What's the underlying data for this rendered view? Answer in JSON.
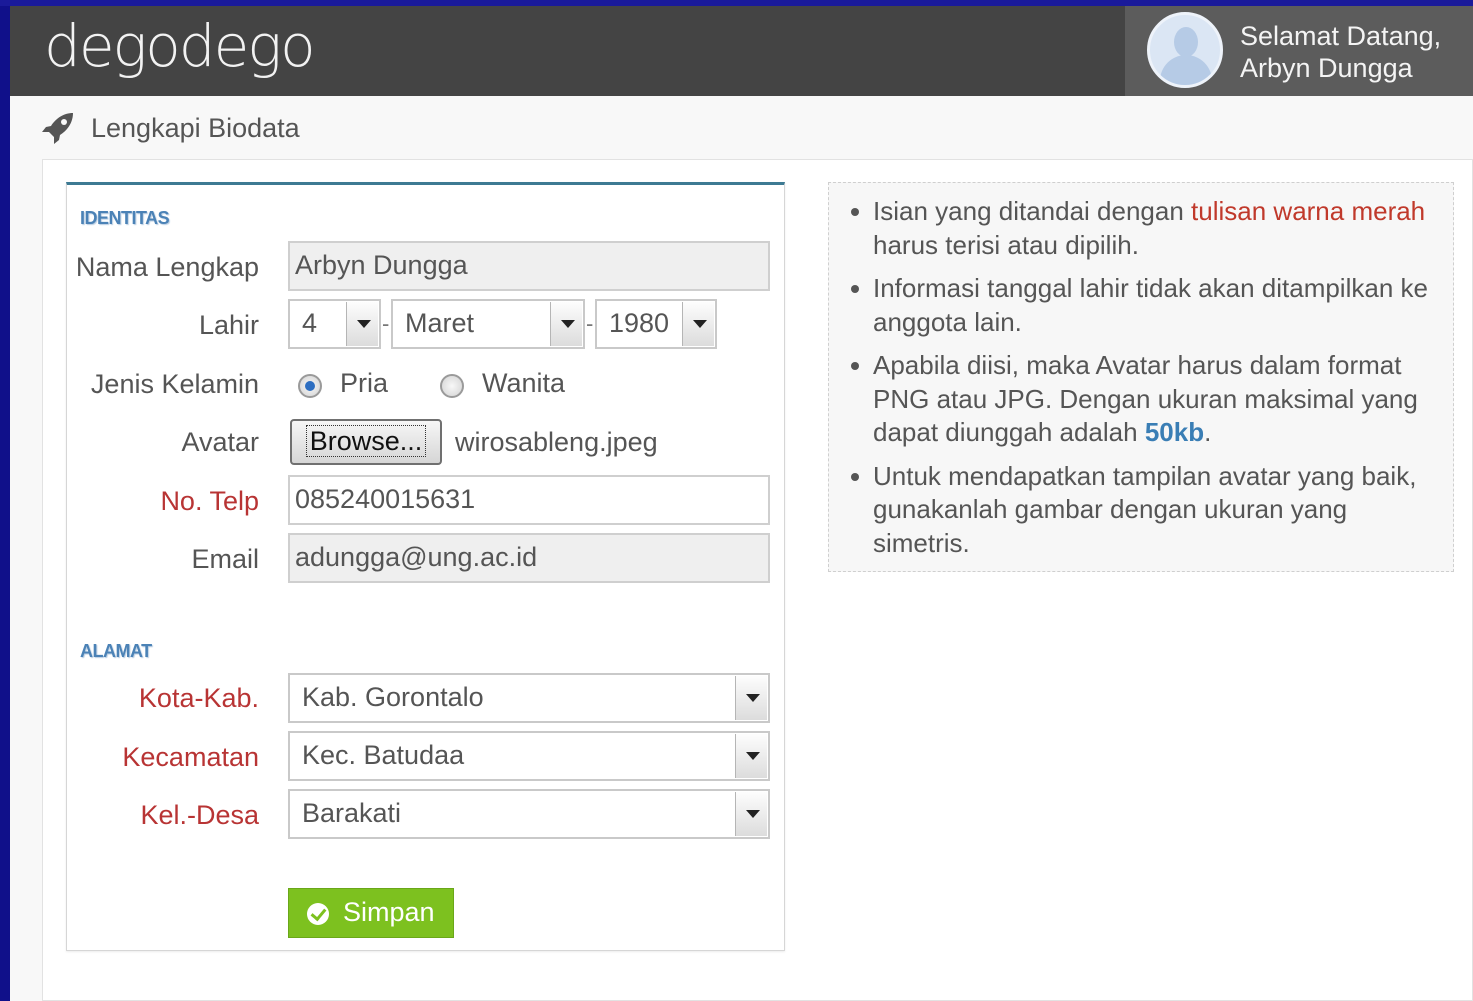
{
  "header": {
    "logo": "degodego",
    "welcome_line1": "Selamat Datang,",
    "welcome_line2": "Arbyn Dungga"
  },
  "page": {
    "title": "Lengkapi Biodata"
  },
  "form": {
    "section_identity": "IDENTITAS",
    "name_label": "Nama Lengkap",
    "name_value": "Arbyn Dungga",
    "birth_label": "Lahir",
    "birth_day": "4",
    "birth_month": "Maret",
    "birth_year": "1980",
    "gender_label": "Jenis Kelamin",
    "gender_options": [
      "Pria",
      "Wanita"
    ],
    "gender_selected": "Pria",
    "avatar_label": "Avatar",
    "browse_label": "Browse...",
    "avatar_file": "wirosableng.jpeg",
    "phone_label": "No. Telp",
    "phone_value": "085240015631",
    "email_label": "Email",
    "email_value": "adungga@ung.ac.id",
    "section_address": "ALAMAT",
    "city_label": "Kota-Kab.",
    "city_value": "Kab. Gorontalo",
    "district_label": "Kecamatan",
    "district_value": "Kec. Batudaa",
    "village_label": "Kel.-Desa",
    "village_value": "Barakati",
    "save_label": "Simpan"
  },
  "info": {
    "item1_a": "Isian yang ditandai dengan ",
    "item1_red": "tulisan warna merah",
    "item1_b": " harus terisi atau dipilih.",
    "item2": "Informasi tanggal lahir tidak akan ditampilkan ke anggota lain.",
    "item3_a": "Apabila diisi, maka Avatar harus dalam format PNG atau JPG. Dengan ukuran maksimal yang dapat diunggah adalah ",
    "item3_strong": "50kb",
    "item3_b": ".",
    "item4": "Untuk mendapatkan tampilan avatar yang baik, gunakanlah gambar dengan ukuran yang simetris."
  },
  "colors": {
    "header_bg": "#444444",
    "accent_bar": "#3d7a93",
    "required_label": "#b83434",
    "save_button": "#7dc11f",
    "section_title": "#4b82b6"
  },
  "icons": {
    "page_title": "rocket-icon",
    "save": "check-circle-icon",
    "user": "user-avatar"
  }
}
